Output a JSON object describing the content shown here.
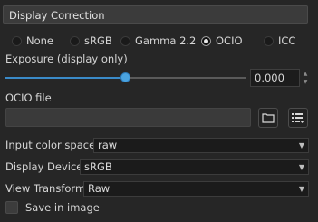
{
  "panel": {
    "title": "Display Correction"
  },
  "display_modes": [
    "None",
    "sRGB",
    "Gamma 2.2",
    "OCIO",
    "ICC"
  ],
  "display_mode_selected": "OCIO",
  "exposure": {
    "label": "Exposure (display only)",
    "value": "0.000",
    "slider_fraction": 0.5
  },
  "ocio": {
    "file_label": "OCIO file",
    "file_value": ""
  },
  "input_color_space": {
    "label": "Input color space",
    "value": "raw"
  },
  "display_device": {
    "label": "Display Device",
    "value": "sRGB"
  },
  "view_transform": {
    "label": "View Transform",
    "value": "Raw"
  },
  "save_in_image": {
    "label": "Save in image",
    "checked": false
  },
  "accent_color": "#4aa3e0"
}
